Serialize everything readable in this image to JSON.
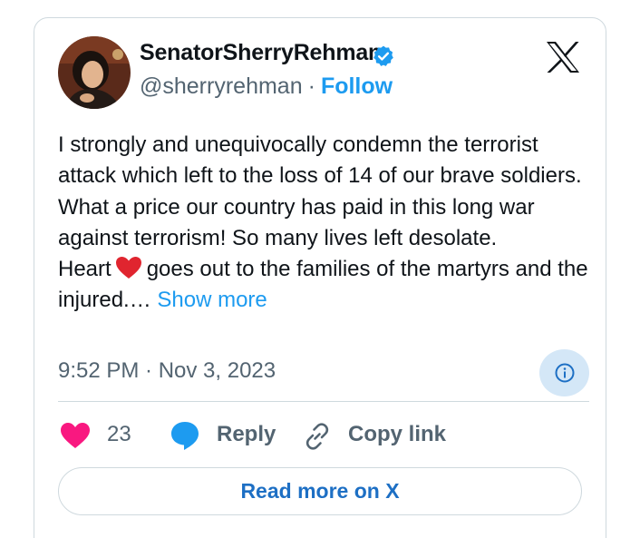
{
  "user": {
    "display_name": "SenatorSherryRehman",
    "handle": "@sherryrehman",
    "separator": "·",
    "follow_label": "Follow"
  },
  "tweet": {
    "lines": [
      "I strongly and unequivocally condemn the terrorist attack which left to the loss of 14 of our brave soldiers.",
      "What a price our country has paid in this long war against terrorism! So many lives left desolate."
    ],
    "heart_prefix": "Heart",
    "heart_suffix": "goes out to the families of the martyrs and the injured.…",
    "show_more": "Show more"
  },
  "timestamp": "9:52 PM · Nov 3, 2023",
  "actions": {
    "like_count": "23",
    "reply_label": "Reply",
    "copy_label": "Copy link"
  },
  "read_more_label": "Read more on X",
  "colors": {
    "accent": "#1d9bf0",
    "heart": "#f91880",
    "heart_emoji": "#e0252f",
    "text": "#0f1419",
    "muted": "#536471"
  },
  "icons": [
    "avatar",
    "verified-badge-icon",
    "x-logo-icon",
    "heart-emoji-icon",
    "info-icon",
    "heart-icon",
    "reply-bubble-icon",
    "link-icon"
  ]
}
